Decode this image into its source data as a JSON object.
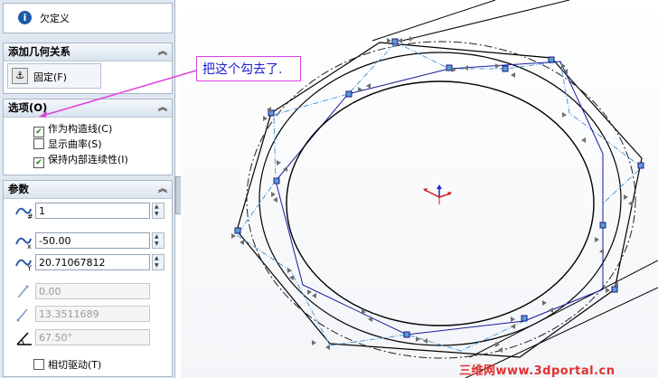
{
  "status": {
    "label": "欠定义"
  },
  "relations": {
    "title": "添加几何关系",
    "fix_label": "固定(F)"
  },
  "options": {
    "title": "选项(O)",
    "items": [
      {
        "label": "作为构造线(C)",
        "checked": true
      },
      {
        "label": "显示曲率(S)",
        "checked": false
      },
      {
        "label": "保持内部连续性(I)",
        "checked": true
      }
    ]
  },
  "params": {
    "title": "参数",
    "count_value": "1",
    "x_value": "-50.00",
    "y_value": "20.71067812",
    "disabled1_value": "0.00",
    "disabled2_value": "13.3511689",
    "angle_value": "67.50°",
    "tangent_label": "相切驱动(T)"
  },
  "annotation": {
    "text": "把这个勾去了."
  },
  "watermark": {
    "text": "三维网www.3dportal.cn"
  },
  "colors": {
    "callout_border": "#e040e0",
    "callout_text": "#1a1ad0",
    "spline": "#1a1aa0",
    "construction": "#4a9ad8"
  }
}
